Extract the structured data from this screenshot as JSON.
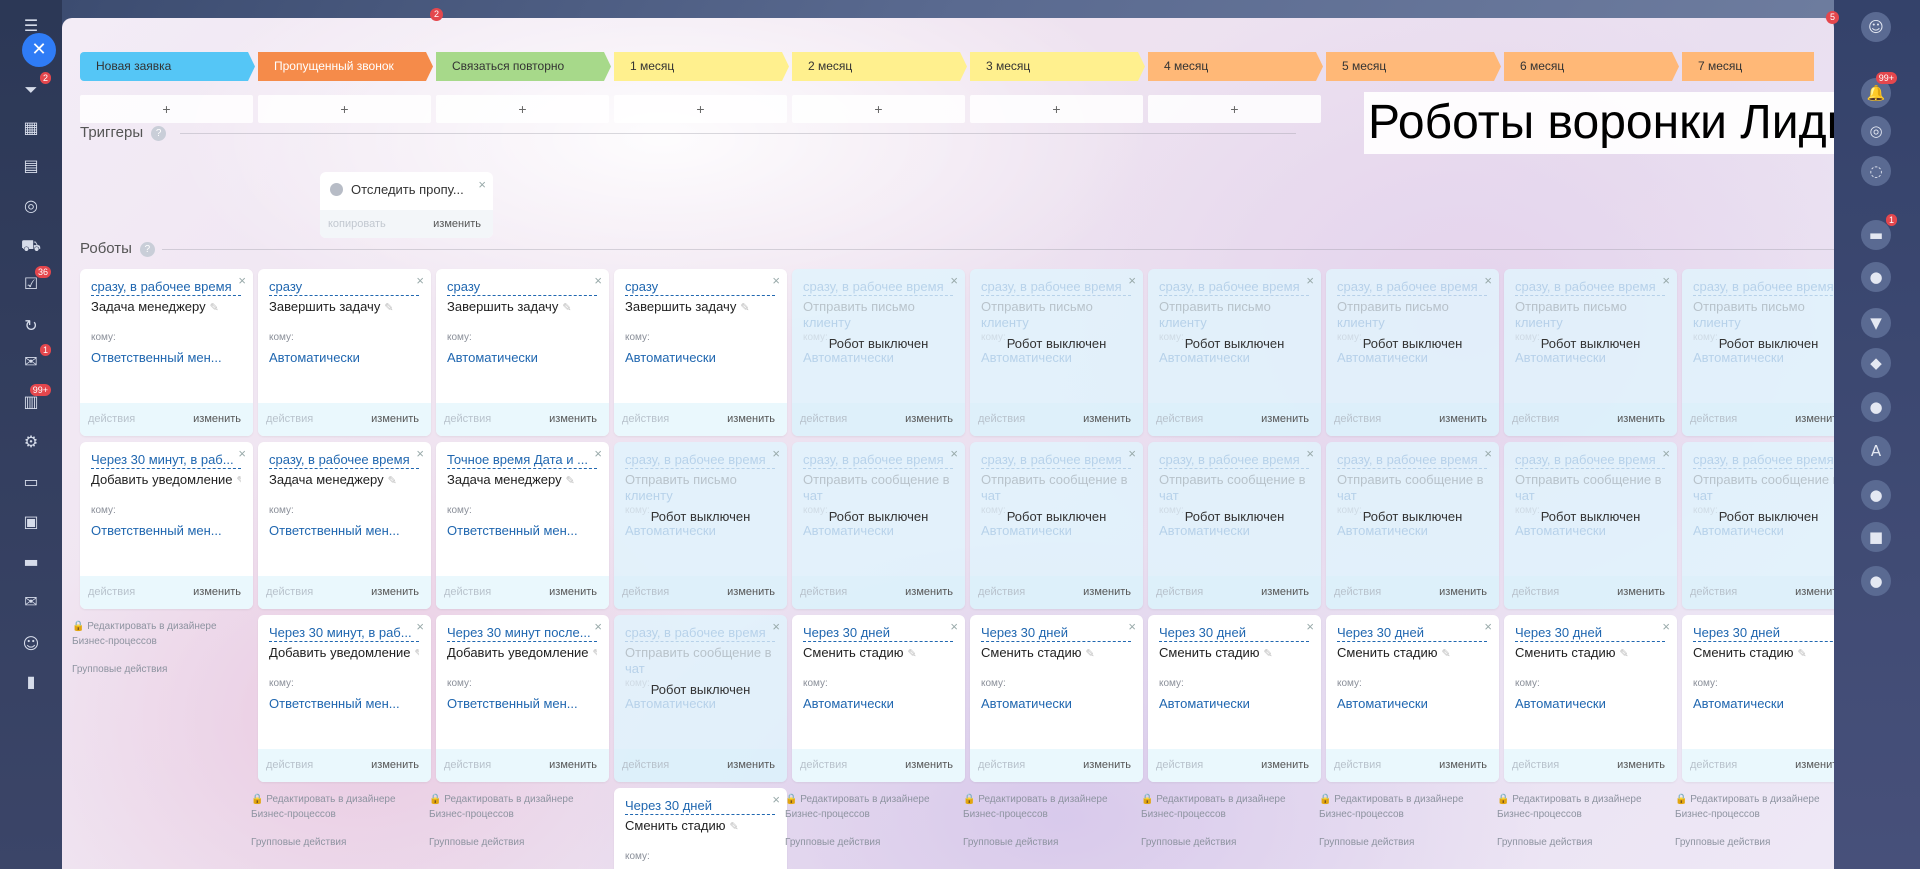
{
  "left_sidebar": {
    "icons": [
      {
        "name": "menu-icon",
        "glyph": "☰",
        "count": ""
      },
      {
        "name": "funnel-icon",
        "glyph": "⏷",
        "count": "2"
      },
      {
        "name": "calendar-icon",
        "glyph": "▦",
        "count": ""
      },
      {
        "name": "inbox-icon",
        "glyph": "▤",
        "count": ""
      },
      {
        "name": "target-icon",
        "glyph": "◎",
        "count": ""
      },
      {
        "name": "cart-icon",
        "glyph": "⛟",
        "count": ""
      },
      {
        "name": "tasks-icon",
        "glyph": "☑",
        "count": "36"
      },
      {
        "name": "sync-icon",
        "glyph": "↻",
        "count": ""
      },
      {
        "name": "chat-icon",
        "glyph": "✉",
        "count": "1"
      },
      {
        "name": "docs-icon",
        "glyph": "▥",
        "count": "99+"
      },
      {
        "name": "settings-icon",
        "glyph": "⚙",
        "count": ""
      },
      {
        "name": "file-icon",
        "glyph": "▭",
        "count": ""
      },
      {
        "name": "monitor-icon",
        "glyph": "▣",
        "count": ""
      },
      {
        "name": "drive-icon",
        "glyph": "▬",
        "count": ""
      },
      {
        "name": "mail-icon",
        "glyph": "✉",
        "count": ""
      },
      {
        "name": "contacts-icon",
        "glyph": "☺",
        "count": ""
      },
      {
        "name": "analytics-icon",
        "glyph": "▮",
        "count": ""
      }
    ]
  },
  "top_badges": {
    "left": "2",
    "right": "5"
  },
  "right_sidebar": {
    "icons": [
      {
        "name": "user-avatar-icon",
        "glyph": "☺",
        "count": ""
      },
      {
        "name": "bell-icon",
        "glyph": "🔔",
        "count": "99+"
      },
      {
        "name": "fingerprint-icon",
        "glyph": "◎",
        "count": ""
      },
      {
        "name": "chat-bubble-icon",
        "glyph": "◌",
        "count": ""
      },
      {
        "name": "messenger-icon",
        "glyph": "▬",
        "count": "1"
      },
      {
        "name": "contact-avatar-icon",
        "glyph": "●",
        "count": ""
      },
      {
        "name": "bookmark-icon",
        "glyph": "▼",
        "count": ""
      },
      {
        "name": "bot-avatar-icon",
        "glyph": "◆",
        "count": ""
      },
      {
        "name": "person-avatar-icon",
        "glyph": "●",
        "count": ""
      },
      {
        "name": "letter-avatar-icon",
        "glyph": "A",
        "count": ""
      },
      {
        "name": "woman-avatar-icon",
        "glyph": "●",
        "count": ""
      },
      {
        "name": "open-channel-icon",
        "glyph": "■",
        "count": ""
      },
      {
        "name": "group-avatar-icon",
        "glyph": "●",
        "count": ""
      }
    ]
  },
  "title": "Роботы воронки Лиды",
  "stages": [
    {
      "label": "Новая заявка",
      "color": "#55c6f6"
    },
    {
      "label": "Пропущенный звонок",
      "color": "#f58b4a"
    },
    {
      "label": "Связаться повторно",
      "color": "#a7d98a"
    },
    {
      "label": "1 месяц",
      "color": "#fff08e"
    },
    {
      "label": "2 месяц",
      "color": "#fff08e"
    },
    {
      "label": "3 месяц",
      "color": "#fff08e"
    },
    {
      "label": "4 месяц",
      "color": "#ffb877"
    },
    {
      "label": "5 месяц",
      "color": "#ffb877"
    },
    {
      "label": "6 месяц",
      "color": "#ffb877"
    },
    {
      "label": "7 месяц",
      "color": "#ffb877"
    }
  ],
  "plus_label": "+",
  "triggers": {
    "label": "Триггеры",
    "help": "?",
    "card": {
      "name": "Отследить пропу...",
      "copy": "копировать",
      "edit": "изменить",
      "close": "×"
    }
  },
  "robots": {
    "label": "Роботы",
    "help": "?",
    "to_label": "кому:",
    "actions_label": "действия",
    "edit_label": "изменить",
    "close": "×",
    "disabled_label": "Робот выключен",
    "bp_edit": "Редактировать в дизайнере Бизнес-процессов",
    "bp_edit_line1": "Редактировать в дизайнере",
    "bp_edit_line2": "Бизнес-процессов",
    "group_actions": "Групповые действия",
    "row1": [
      {
        "when": "сразу, в рабочее время",
        "action": "Задача менеджеру",
        "to": "Ответственный мен...",
        "off": false
      },
      {
        "when": "сразу",
        "action": "Завершить задачу",
        "to": "Автоматически",
        "off": false
      },
      {
        "when": "сразу",
        "action": "Завершить задачу",
        "to": "Автоматически",
        "off": false
      },
      {
        "when": "сразу",
        "action": "Завершить задачу",
        "to": "Автоматически",
        "off": false
      },
      {
        "when": "сразу, в рабочее время",
        "action": "Отправить письмо",
        "extra": "клиенту",
        "to": "Автоматически",
        "off": true
      },
      {
        "when": "сразу, в рабочее время",
        "action": "Отправить письмо",
        "extra": "клиенту",
        "to": "Автоматически",
        "off": true
      },
      {
        "when": "сразу, в рабочее время",
        "action": "Отправить письмо",
        "extra": "клиенту",
        "to": "Автоматически",
        "off": true
      },
      {
        "when": "сразу, в рабочее время",
        "action": "Отправить письмо",
        "extra": "клиенту",
        "to": "Автоматически",
        "off": true
      },
      {
        "when": "сразу, в рабочее время",
        "action": "Отправить письмо",
        "extra": "клиенту",
        "to": "Автоматически",
        "off": true
      },
      {
        "when": "сразу, в рабочее время",
        "action": "Отправить письмо",
        "extra": "клиенту",
        "to": "Автоматически",
        "off": true
      }
    ],
    "row2": [
      {
        "when": "Через 30 минут, в раб...",
        "action": "Добавить уведомление",
        "to": "Ответственный мен...",
        "off": false
      },
      {
        "when": "сразу, в рабочее время",
        "action": "Задача менеджеру",
        "to": "Ответственный мен...",
        "off": false
      },
      {
        "when": "Точное время Дата и ...",
        "action": "Задача менеджеру",
        "to": "Ответственный мен...",
        "off": false
      },
      {
        "when": "сразу, в рабочее время",
        "action": "Отправить письмо",
        "extra": "клиенту",
        "to": "Автоматически",
        "off": true
      },
      {
        "when": "сразу, в рабочее время",
        "action": "Отправить сообщение в",
        "extra": "чат",
        "to": "Автоматически",
        "off": true
      },
      {
        "when": "сразу, в рабочее время",
        "action": "Отправить сообщение в",
        "extra": "чат",
        "to": "Автоматически",
        "off": true
      },
      {
        "when": "сразу, в рабочее время",
        "action": "Отправить сообщение в",
        "extra": "чат",
        "to": "Автоматически",
        "off": true
      },
      {
        "when": "сразу, в рабочее время",
        "action": "Отправить сообщение в",
        "extra": "чат",
        "to": "Автоматически",
        "off": true
      },
      {
        "when": "сразу, в рабочее время",
        "action": "Отправить сообщение в",
        "extra": "чат",
        "to": "Автоматически",
        "off": true
      },
      {
        "when": "сразу, в рабочее время",
        "action": "Отправить сообщение в",
        "extra": "чат",
        "to": "Автоматически",
        "off": true
      }
    ],
    "row3": [
      {
        "when": "Через 30 минут, в раб...",
        "action": "Добавить уведомление",
        "to": "Ответственный мен...",
        "off": false
      },
      {
        "when": "Через 30 минут после...",
        "action": "Добавить уведомление",
        "to": "Ответственный мен...",
        "off": false
      },
      {
        "when": "сразу, в рабочее время",
        "action": "Отправить сообщение в",
        "extra": "чат",
        "to": "Автоматически",
        "off": true
      },
      {
        "when": "Через 30 дней",
        "action": "Сменить стадию",
        "to": "Автоматически",
        "off": false
      },
      {
        "when": "Через 30 дней",
        "action": "Сменить стадию",
        "to": "Автоматически",
        "off": false
      },
      {
        "when": "Через 30 дней",
        "action": "Сменить стадию",
        "to": "Автоматически",
        "off": false
      },
      {
        "when": "Через 30 дней",
        "action": "Сменить стадию",
        "to": "Автоматически",
        "off": false
      },
      {
        "when": "Через 30 дней",
        "action": "Сменить стадию",
        "to": "Автоматически",
        "off": false
      },
      {
        "when": "Через 30 дней",
        "action": "Сменить стадию",
        "to": "Автоматически",
        "off": false
      }
    ],
    "row4": [
      {
        "when": "Через 30 дней",
        "action": "Сменить стадию"
      }
    ]
  }
}
